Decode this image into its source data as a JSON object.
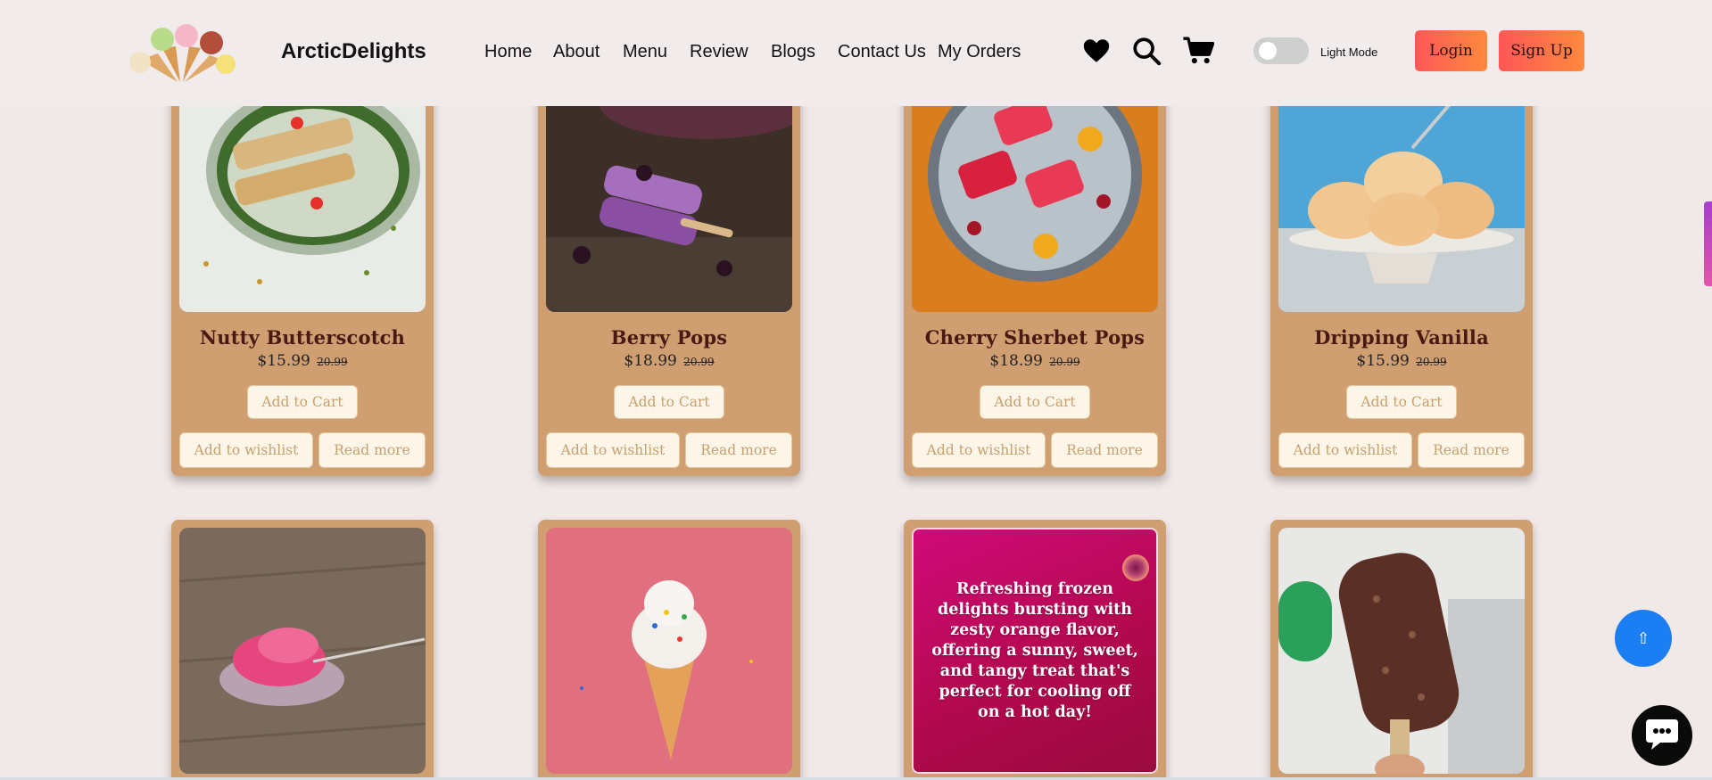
{
  "header": {
    "brand": "ArcticDelights",
    "nav": [
      "Home",
      "About",
      "Menu",
      "Review",
      "Blogs",
      "Contact Us",
      "My Orders"
    ],
    "icons": [
      "heart-icon",
      "search-icon",
      "cart-icon"
    ],
    "theme_toggle_label": "Light Mode",
    "login_label": "Login",
    "signup_label": "Sign Up"
  },
  "products": [
    {
      "name": "Nutty Butterscotch",
      "price": "$15.99",
      "old_price": "20.99"
    },
    {
      "name": "Berry Pops",
      "price": "$18.99",
      "old_price": "20.99"
    },
    {
      "name": "Cherry Sherbet Pops",
      "price": "$18.99",
      "old_price": "20.99"
    },
    {
      "name": "Dripping Vanilla",
      "price": "$15.99",
      "old_price": "20.99"
    }
  ],
  "buttons": {
    "add_to_cart": "Add to Cart",
    "add_to_wishlist": "Add to wishlist",
    "read_more": "Read more"
  },
  "hover_description": "Refreshing frozen delights bursting with zesty orange flavor, offering a sunny, sweet, and tangy treat that's perfect for cooling off on a hot day!",
  "floating": {
    "scroll_top_icon": "⇧"
  },
  "colors": {
    "card": "#cf9f72",
    "accent_gradient_start": "#ff5757",
    "accent_gradient_end": "#ff8a3d",
    "scroll_top": "#1b7ef2"
  }
}
